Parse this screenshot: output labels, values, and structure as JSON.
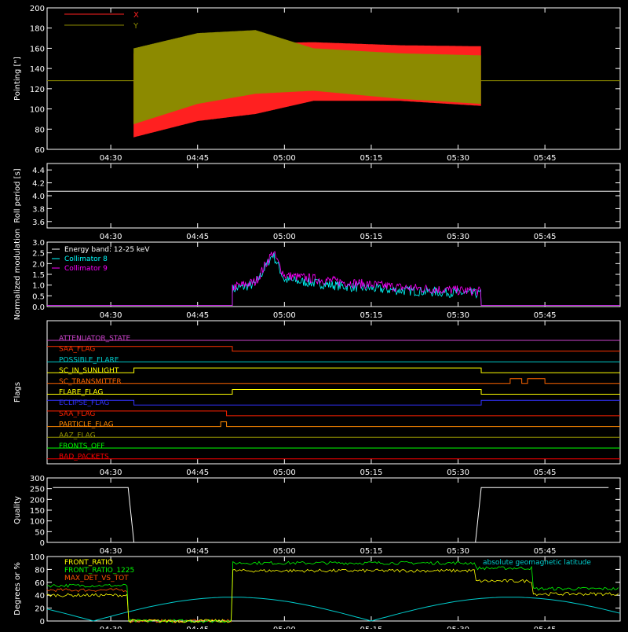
{
  "time_ticks": [
    "04:30",
    "04:45",
    "05:00",
    "05:15",
    "05:30",
    "05:45"
  ],
  "chart_data": [
    {
      "id": "pointing",
      "type": "line",
      "ylabel": "Pointing [\"]",
      "ylim": [
        60,
        200
      ],
      "yticks": [
        "60",
        "80",
        "100",
        "120",
        "140",
        "160",
        "180",
        "200"
      ],
      "legend": [
        {
          "name": "X",
          "color": "#ff2020"
        },
        {
          "name": "Y",
          "color": "#8c8a00"
        }
      ],
      "series": [
        {
          "name": "X",
          "color": "#ff2020",
          "x": [
            "04:34",
            "04:45",
            "04:55",
            "05:05",
            "05:20",
            "05:34"
          ],
          "max": [
            155,
            160,
            165,
            166,
            163,
            162
          ],
          "min": [
            72,
            88,
            95,
            108,
            108,
            103
          ]
        },
        {
          "name": "Y",
          "color": "#8c8a00",
          "x": [
            "04:34",
            "04:45",
            "04:55",
            "05:05",
            "05:20",
            "05:34"
          ],
          "max": [
            160,
            175,
            178,
            160,
            155,
            153
          ],
          "min": [
            85,
            105,
            115,
            118,
            110,
            105
          ],
          "baseline": 128
        }
      ]
    },
    {
      "id": "roll",
      "type": "line",
      "ylabel": "Roll period [s]",
      "ylim": [
        3.5,
        4.5
      ],
      "yticks": [
        "3.6",
        "3.8",
        "4.0",
        "4.2",
        "4.4"
      ],
      "series": [
        {
          "name": "roll",
          "color": "#ffffff",
          "value": 4.07
        }
      ]
    },
    {
      "id": "modulation",
      "type": "line",
      "ylabel": "Normalized modulation",
      "ylim": [
        0,
        3.0
      ],
      "yticks": [
        "0.0",
        "0.5",
        "1.0",
        "1.5",
        "2.0",
        "2.5",
        "3.0"
      ],
      "legend": [
        {
          "name": "Energy band: 12-25 keV",
          "color": "#ffffff"
        },
        {
          "name": "Collimator 8",
          "color": "#00ffff"
        },
        {
          "name": "Collimator 9",
          "color": "#ff00ff"
        }
      ],
      "series": [
        {
          "name": "Collimator 8",
          "color": "#00ffff",
          "x": [
            "04:51",
            "04:55",
            "04:58",
            "05:00",
            "05:10",
            "05:20",
            "05:34"
          ],
          "y": [
            0.75,
            1.0,
            2.4,
            1.2,
            0.9,
            0.7,
            0.55
          ]
        },
        {
          "name": "Collimator 9",
          "color": "#ff00ff",
          "x": [
            "04:51",
            "04:55",
            "04:58",
            "05:00",
            "05:10",
            "05:20",
            "05:34"
          ],
          "y": [
            0.85,
            1.1,
            2.5,
            1.4,
            1.1,
            0.85,
            0.65
          ]
        }
      ]
    },
    {
      "id": "flags",
      "type": "line",
      "ylabel": "Flags",
      "series": [
        {
          "name": "ATTENUATOR_STATE",
          "color": "#cc44cc"
        },
        {
          "name": "SAA_FLAG",
          "color": "#ff3300"
        },
        {
          "name": "POSSIBLE_FLARE",
          "color": "#00cccc"
        },
        {
          "name": "SC_IN_SUNLIGHT",
          "color": "#ffff00"
        },
        {
          "name": "SC_TRANSMITTER",
          "color": "#ff6600"
        },
        {
          "name": "FLARE_FLAG",
          "color": "#ffff00"
        },
        {
          "name": "ECLIPSE_FLAG",
          "color": "#3333ff"
        },
        {
          "name": "SAA_FLAG",
          "color": "#ff2200"
        },
        {
          "name": "PARTICLE_FLAG",
          "color": "#ff8800"
        },
        {
          "name": "AAZ_FLAG",
          "color": "#999900"
        },
        {
          "name": "FRONTS_OFF",
          "color": "#00ff00"
        },
        {
          "name": "BAD_PACKETS",
          "color": "#ff0000"
        }
      ]
    },
    {
      "id": "quality",
      "type": "line",
      "ylabel": "Quality",
      "ylim": [
        0,
        300
      ],
      "yticks": [
        "0",
        "50",
        "100",
        "150",
        "200",
        "250",
        "300"
      ],
      "series": [
        {
          "name": "Quality",
          "color": "#ffffff",
          "x": [
            "04:20",
            "04:33",
            "04:34",
            "05:33",
            "05:34",
            "05:56"
          ],
          "y": [
            255,
            255,
            0,
            0,
            255,
            255
          ]
        }
      ]
    },
    {
      "id": "ratios",
      "type": "line",
      "ylabel": "Degrees or %",
      "ylim": [
        0,
        100
      ],
      "yticks": [
        "0",
        "20",
        "40",
        "60",
        "80",
        "100"
      ],
      "legend": [
        {
          "name": "FRONT_RATIO",
          "color": "#ffff00"
        },
        {
          "name": "FRONT_RATIO_1225",
          "color": "#00ff00"
        },
        {
          "name": "MAX_DET_VS_TOT",
          "color": "#ff5500"
        }
      ],
      "annotation": "absolute geomagnetic latitude",
      "series": [
        {
          "name": "FRONT_RATIO",
          "color": "#ffff00"
        },
        {
          "name": "FRONT_RATIO_1225",
          "color": "#00ff00"
        },
        {
          "name": "MAX_DET_VS_TOT",
          "color": "#ff5500"
        },
        {
          "name": "absolute geomagnetic latitude",
          "color": "#00cccc"
        }
      ]
    }
  ]
}
